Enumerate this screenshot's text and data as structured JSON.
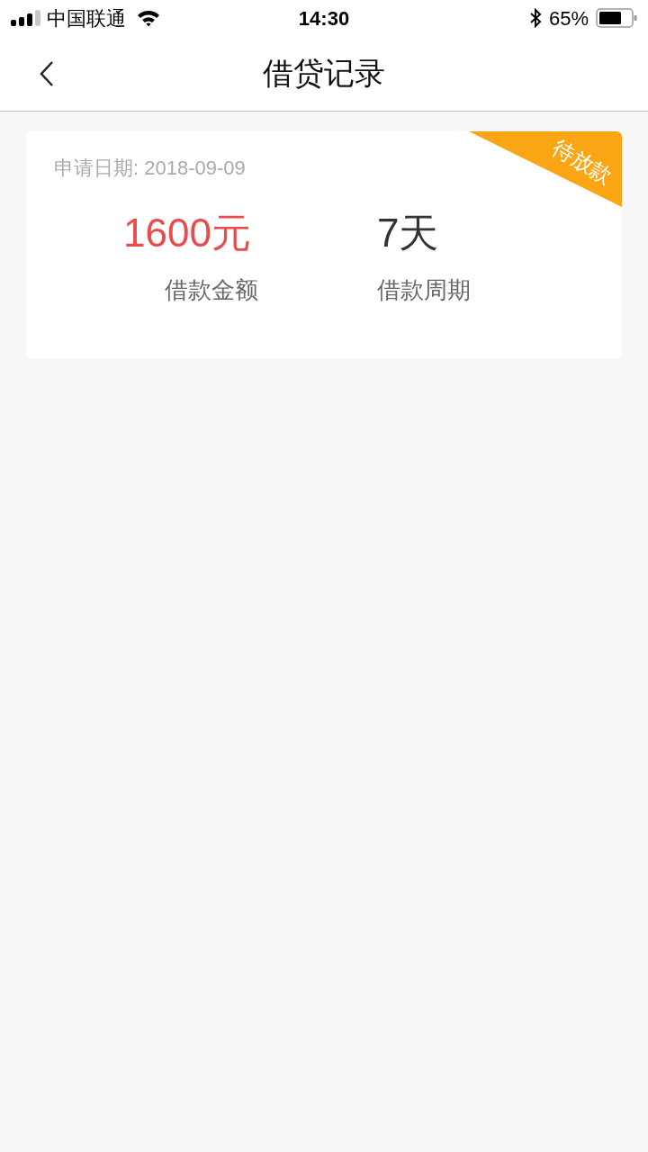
{
  "status_bar": {
    "carrier": "中国联通",
    "time": "14:30",
    "battery": "65%"
  },
  "nav": {
    "title": "借贷记录"
  },
  "records": [
    {
      "date": "申请日期: 2018-09-09",
      "status": "待放款",
      "amount": "1600元",
      "amount_label": "借款金额",
      "period": "7天",
      "period_label": "借款周期"
    }
  ]
}
